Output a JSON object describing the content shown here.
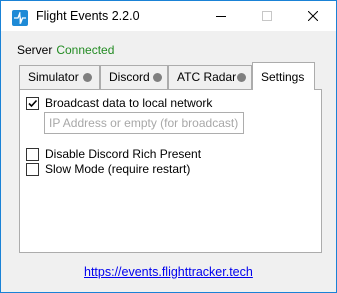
{
  "window": {
    "title": "Flight Events 2.2.0",
    "accent_color": "#1a82d6",
    "icon": "app-icon"
  },
  "server": {
    "label": "Server",
    "status": "Connected",
    "status_color": "#228b22"
  },
  "tabs": [
    {
      "label": "Simulator",
      "indicator": "status-dot-icon",
      "indicator_color": "#7f7f7f",
      "selected": false
    },
    {
      "label": "Discord",
      "indicator": "status-dot-icon",
      "indicator_color": "#7f7f7f",
      "selected": false
    },
    {
      "label": "ATC Radar",
      "indicator": "status-dot-icon",
      "indicator_color": "#7f7f7f",
      "selected": false
    },
    {
      "label": "Settings",
      "selected": true
    }
  ],
  "settings": {
    "broadcast": {
      "label": "Broadcast data to local network",
      "checked": true
    },
    "ip_input": {
      "value": "",
      "placeholder": "IP Address or empty (for broadcast)"
    },
    "disable_discord": {
      "label": "Disable Discord Rich Present",
      "checked": false
    },
    "slow_mode": {
      "label": "Slow Mode (require restart)",
      "checked": false
    }
  },
  "footer": {
    "link": "https://events.flighttracker.tech"
  }
}
